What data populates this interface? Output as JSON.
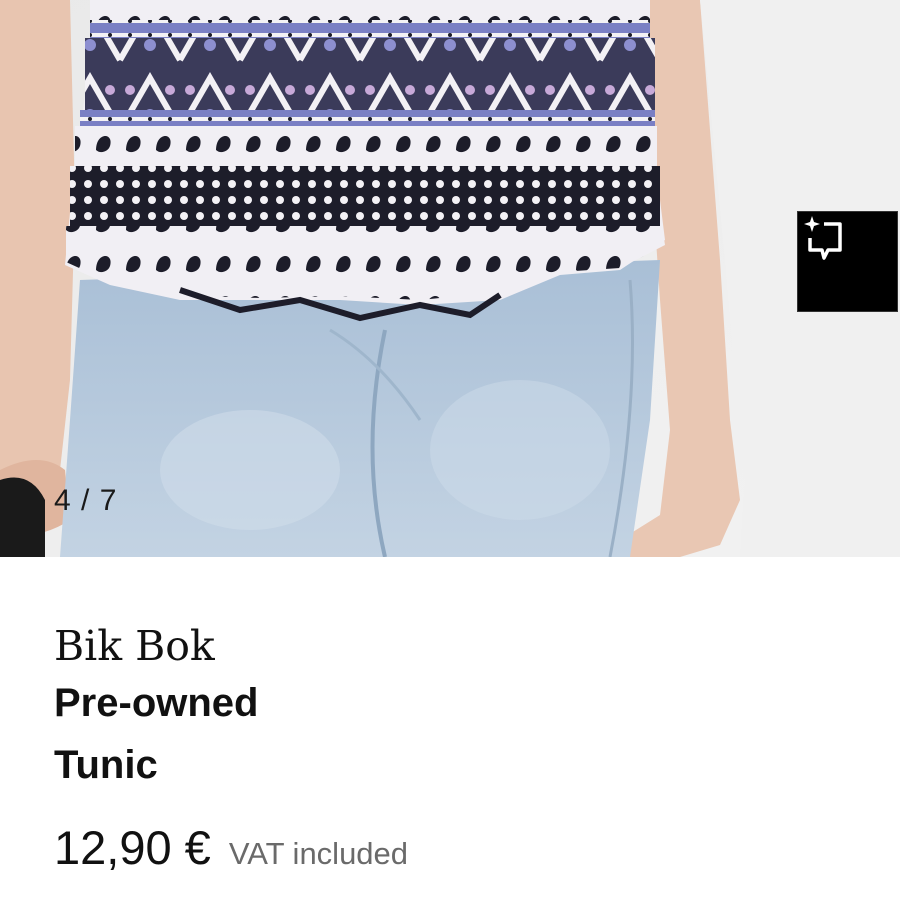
{
  "gallery": {
    "counter": "4 / 7",
    "current_image": 4,
    "total_images": 7,
    "ai_button_icon": "sparkle-crop-icon"
  },
  "product": {
    "brand": "Bik Bok",
    "condition": "Pre-owned",
    "type": "Tunic",
    "price": "12,90 €",
    "vat_note": "VAT included"
  },
  "colors": {
    "jeans": "#b3c8dc",
    "print_blue": "#7a7fc4",
    "print_dark": "#1d1d2a",
    "button_bg": "#000000",
    "vat_text": "#6a6a6a"
  }
}
